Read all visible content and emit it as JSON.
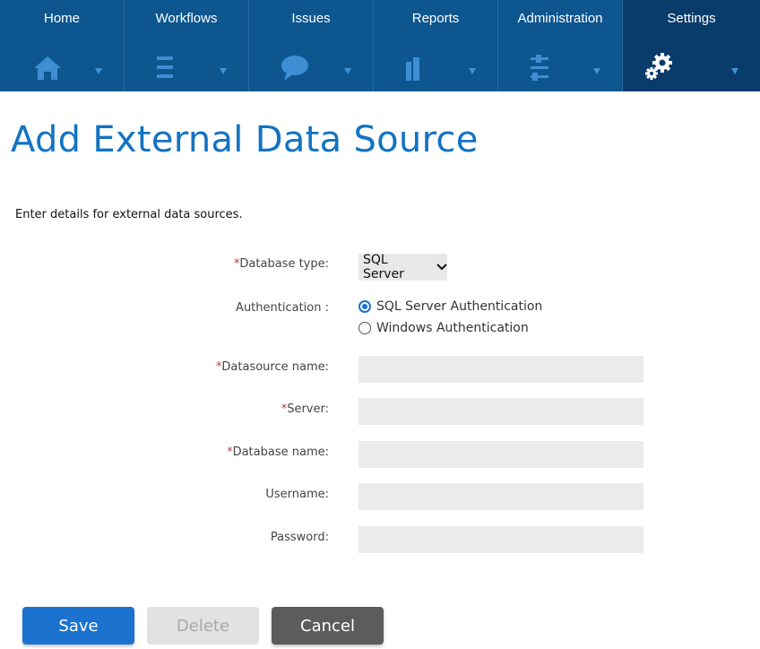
{
  "nav": {
    "items": [
      {
        "label": "Home",
        "icon": "home-icon"
      },
      {
        "label": "Workflows",
        "icon": "numbered-list-icon"
      },
      {
        "label": "Issues",
        "icon": "speech-bubble-icon"
      },
      {
        "label": "Reports",
        "icon": "bar-chart-icon"
      },
      {
        "label": "Administration",
        "icon": "sliders-icon"
      },
      {
        "label": "Settings",
        "icon": "gears-icon",
        "active": true
      }
    ]
  },
  "page": {
    "title": "Add External Data Source",
    "intro": "Enter details for external data sources."
  },
  "form": {
    "required_mark": "*",
    "database_type_label": "Database type:",
    "database_type_value": "SQL Server",
    "authentication_label": "Authentication :",
    "auth_options": [
      "SQL Server Authentication",
      "Windows Authentication"
    ],
    "auth_selected": "SQL Server Authentication",
    "datasource_name_label": "Datasource name:",
    "datasource_name_value": "",
    "server_label": "Server:",
    "server_value": "",
    "database_name_label": "Database name:",
    "database_name_value": "",
    "username_label": "Username:",
    "username_value": "",
    "password_label": "Password:",
    "password_value": ""
  },
  "buttons": {
    "save": "Save",
    "delete": "Delete",
    "cancel": "Cancel"
  },
  "colors": {
    "nav_bg": "#0d568f",
    "nav_active_bg": "#093c6a",
    "title": "#1373c2",
    "primary": "#1c73cf",
    "required": "#c0393b"
  }
}
